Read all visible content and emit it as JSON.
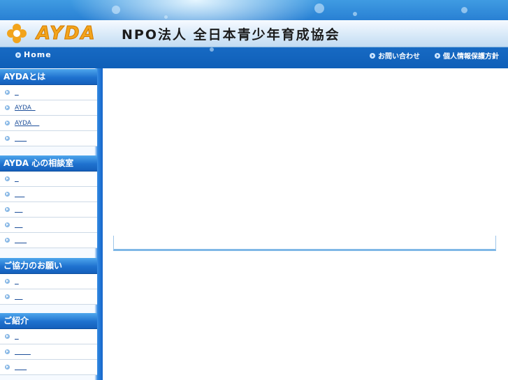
{
  "header": {
    "logo_text": "AYDA",
    "org_name": "NPO法人 全日本青少年育成協会",
    "nav": {
      "home": "Home",
      "contact": "お問い合わせ",
      "privacy": "個人情報保護方針"
    }
  },
  "sidebar": {
    "sections": [
      {
        "title": "AYDAとは",
        "items": [
          "  ",
          "AYDA  ",
          "AYDA    ",
          "      "
        ]
      },
      {
        "title": "AYDA 心の相談室",
        "items": [
          "  ",
          "     ",
          "    ",
          "    ",
          "      "
        ]
      },
      {
        "title": "ご協力のお願い",
        "items": [
          "  ",
          "    "
        ]
      },
      {
        "title": "ご紹介",
        "items": [
          "  ",
          "        ",
          "      "
        ]
      }
    ]
  },
  "colors": {
    "header_blue": "#1d72cc",
    "logo_orange": "#f2a41c",
    "section_blue": "#1f72cf",
    "link_blue": "#1d4f9a"
  }
}
